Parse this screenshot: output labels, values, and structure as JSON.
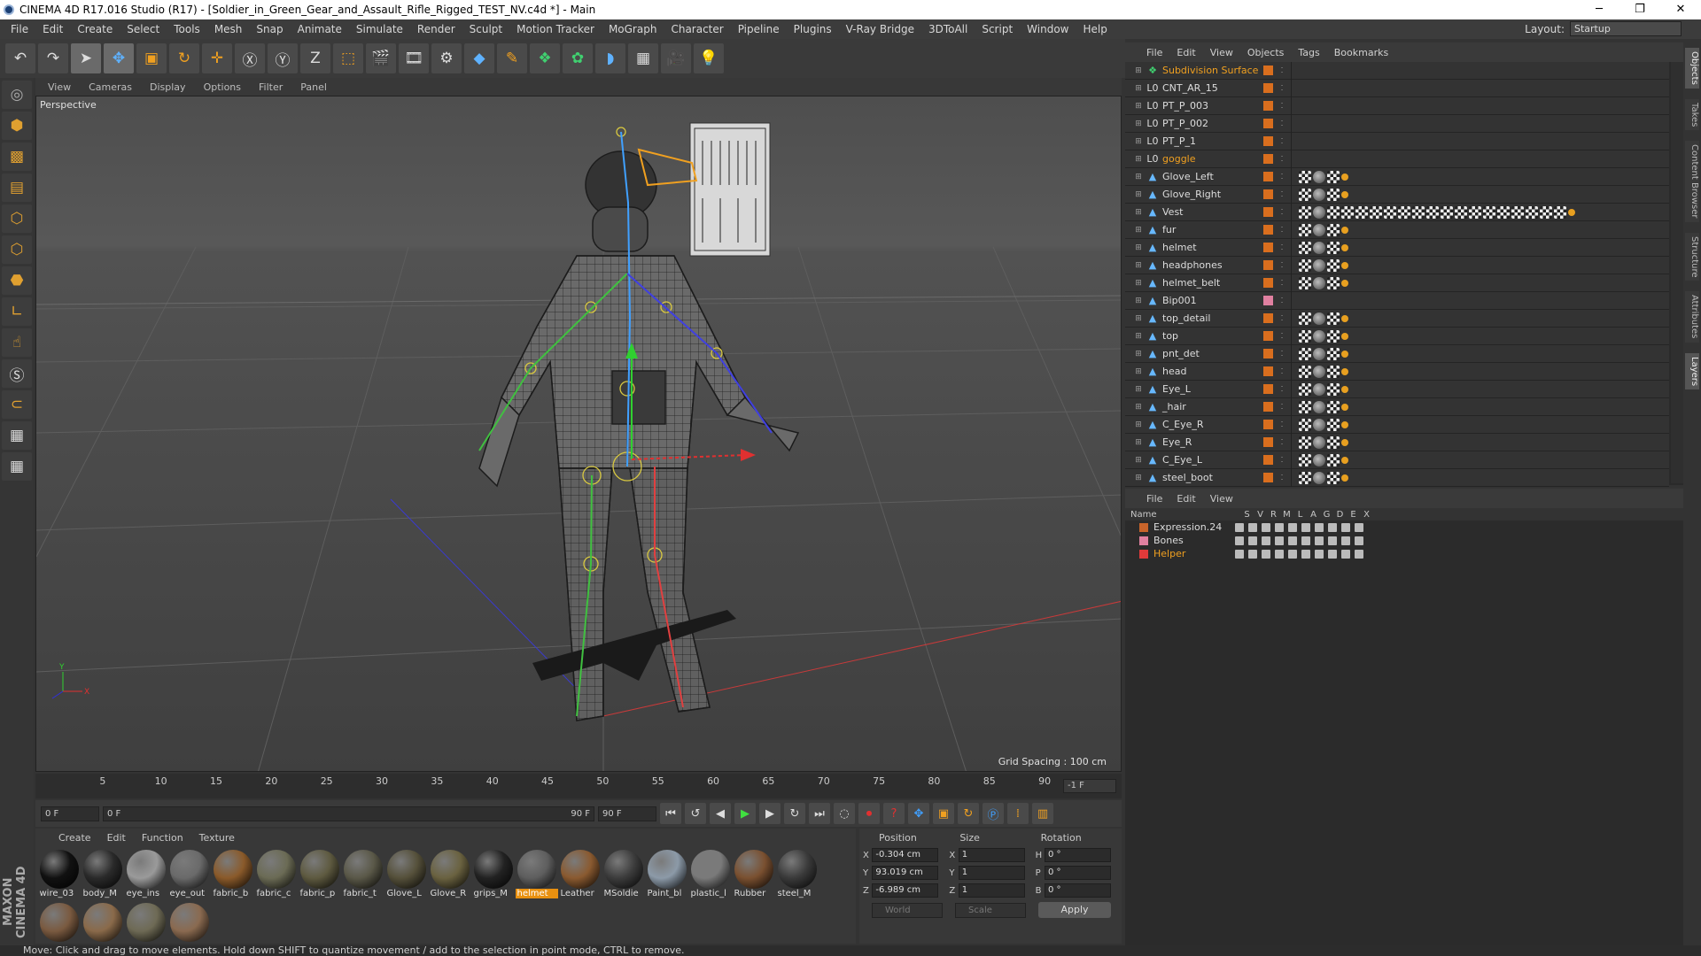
{
  "window": {
    "title": "CINEMA 4D R17.016 Studio (R17) - [Soldier_in_Green_Gear_and_Assault_Rifle_Rigged_TEST_NV.c4d *] - Main"
  },
  "menu": [
    "File",
    "Edit",
    "Create",
    "Select",
    "Tools",
    "Mesh",
    "Snap",
    "Animate",
    "Simulate",
    "Render",
    "Sculpt",
    "Motion Tracker",
    "MoGraph",
    "Character",
    "Pipeline",
    "Plugins",
    "V-Ray Bridge",
    "3DToAll",
    "Script",
    "Window",
    "Help"
  ],
  "layout": {
    "label": "Layout:",
    "value": "Startup"
  },
  "viewport": {
    "menu": [
      "View",
      "Cameras",
      "Display",
      "Options",
      "Filter",
      "Panel"
    ],
    "label": "Perspective",
    "grid_spacing": "Grid Spacing : 100 cm"
  },
  "timeline": {
    "ticks": [
      "5",
      "10",
      "15",
      "20",
      "25",
      "30",
      "35",
      "40",
      "45",
      "50",
      "55",
      "60",
      "65",
      "70",
      "75",
      "80",
      "85",
      "90"
    ],
    "frame_display": "-1 F"
  },
  "transport": {
    "start": "0 F",
    "range_start": "0 F",
    "range_end": "90 F",
    "end": "90 F"
  },
  "materials": {
    "menu": [
      "Create",
      "Edit",
      "Function",
      "Texture"
    ],
    "items": [
      {
        "name": "wire_03",
        "color": "#111111"
      },
      {
        "name": "body_M",
        "color": "#2a2a2a"
      },
      {
        "name": "eye_ins",
        "color": "#9a9a9a"
      },
      {
        "name": "eye_out",
        "color": "#6a6a6a"
      },
      {
        "name": "fabric_b",
        "color": "#8a5a2a"
      },
      {
        "name": "fabric_c",
        "color": "#6b6b55"
      },
      {
        "name": "fabric_p",
        "color": "#5e5a40"
      },
      {
        "name": "fabric_t",
        "color": "#5a5848"
      },
      {
        "name": "Glove_L",
        "color": "#55503a"
      },
      {
        "name": "Glove_R",
        "color": "#6a6240"
      },
      {
        "name": "grips_M",
        "color": "#222222"
      },
      {
        "name": "helmet",
        "color": "#5e5e5e"
      },
      {
        "name": "Leather",
        "color": "#8a5a30"
      },
      {
        "name": "MSoldie",
        "color": "#3c3c3c"
      },
      {
        "name": "Paint_bl",
        "color": "#8c9aa8"
      },
      {
        "name": "plastic_l",
        "color": "#7a7a7a"
      },
      {
        "name": "Rubber",
        "color": "#7a5030"
      },
      {
        "name": "steel_M",
        "color": "#3a3a3a"
      },
      {
        "name": "",
        "color": "#7a5a40"
      },
      {
        "name": "",
        "color": "#8a6a4a"
      },
      {
        "name": "",
        "color": "#6e6a55"
      },
      {
        "name": "",
        "color": "#8a6a50"
      }
    ],
    "selected": "helmet"
  },
  "attributes": {
    "headers": [
      "Position",
      "Size",
      "Rotation"
    ],
    "rows": [
      {
        "axis": "X",
        "pos": "-0.304 cm",
        "size_axis": "X",
        "size": "1",
        "rot_axis": "H",
        "rot": "0 °"
      },
      {
        "axis": "Y",
        "pos": "93.019 cm",
        "size_axis": "Y",
        "size": "1",
        "rot_axis": "P",
        "rot": "0 °"
      },
      {
        "axis": "Z",
        "pos": "-6.989 cm",
        "size_axis": "Z",
        "size": "1",
        "rot_axis": "B",
        "rot": "0 °"
      }
    ],
    "coord_mode": "World",
    "size_mode": "Scale",
    "apply_label": "Apply"
  },
  "objects": {
    "menu": [
      "File",
      "Edit",
      "View",
      "Objects",
      "Tags",
      "Bookmarks"
    ],
    "rows": [
      {
        "name": "Subdivision Surface",
        "orange": true
      },
      {
        "name": "CNT_AR_15"
      },
      {
        "name": "PT_P_003"
      },
      {
        "name": "PT_P_002"
      },
      {
        "name": "PT_P_1"
      },
      {
        "name": "goggle",
        "orange": true
      },
      {
        "name": "Glove_Left"
      },
      {
        "name": "Glove_Right"
      },
      {
        "name": "Vest"
      },
      {
        "name": "fur"
      },
      {
        "name": "helmet"
      },
      {
        "name": "headphones"
      },
      {
        "name": "helmet_belt"
      },
      {
        "name": "Bip001"
      },
      {
        "name": "top_detail"
      },
      {
        "name": "top"
      },
      {
        "name": "pnt_det"
      },
      {
        "name": "head"
      },
      {
        "name": "Eye_L"
      },
      {
        "name": "_hair"
      },
      {
        "name": "C_Eye_R"
      },
      {
        "name": "Eye_R"
      },
      {
        "name": "C_Eye_L"
      },
      {
        "name": "steel_boot"
      }
    ]
  },
  "layers": {
    "menu": [
      "File",
      "Edit",
      "View"
    ],
    "name_header": "Name",
    "col_headers": [
      "S",
      "V",
      "R",
      "M",
      "L",
      "A",
      "G",
      "D",
      "E",
      "X"
    ],
    "rows": [
      {
        "name": "Expression.24",
        "color": "#c8642a"
      },
      {
        "name": "Bones",
        "color": "#e080a0"
      },
      {
        "name": "Helper",
        "color": "#e03a3a"
      }
    ]
  },
  "right_tabs": [
    "Objects",
    "Takes",
    "Content Browser",
    "Structure",
    "Attributes",
    "Layers"
  ],
  "status": "Move: Click and drag to move elements. Hold down SHIFT to quantize movement / add to the selection in point mode, CTRL to remove.",
  "brand": "MAXON CINEMA 4D"
}
